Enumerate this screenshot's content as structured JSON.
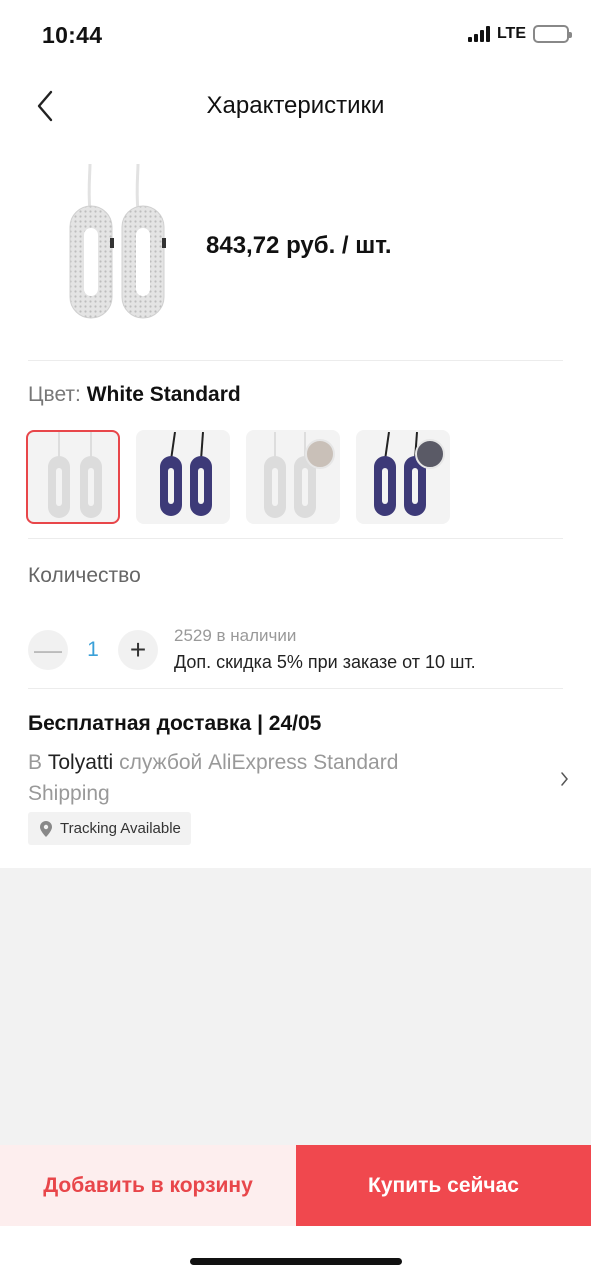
{
  "status_bar": {
    "time": "10:44",
    "network": "LTE",
    "battery_color": "#3ac14a"
  },
  "header": {
    "title": "Характеристики",
    "back_icon": "chevron-left-icon"
  },
  "product": {
    "price": "843,72 руб. / шт."
  },
  "color": {
    "label": "Цвет:",
    "selected": "White Standard",
    "options": [
      {
        "variant": "white",
        "has_badge": false
      },
      {
        "variant": "navy",
        "has_badge": false
      },
      {
        "variant": "white",
        "has_badge": true
      },
      {
        "variant": "navy",
        "has_badge": true
      }
    ],
    "accent": "#e8464a"
  },
  "quantity": {
    "label": "Количество",
    "value": "1",
    "stock": "2529 в наличии",
    "discount": "Доп. скидка 5% при заказе от 10 шт."
  },
  "shipping": {
    "title": "Бесплатная доставка | 24/05",
    "prefix": "В",
    "city": "Tolyatti",
    "suffix": "службой AliExpress Standard Shipping",
    "tracking": "Tracking Available"
  },
  "actions": {
    "add_to_cart": "Добавить в корзину",
    "buy_now": "Купить сейчас"
  }
}
